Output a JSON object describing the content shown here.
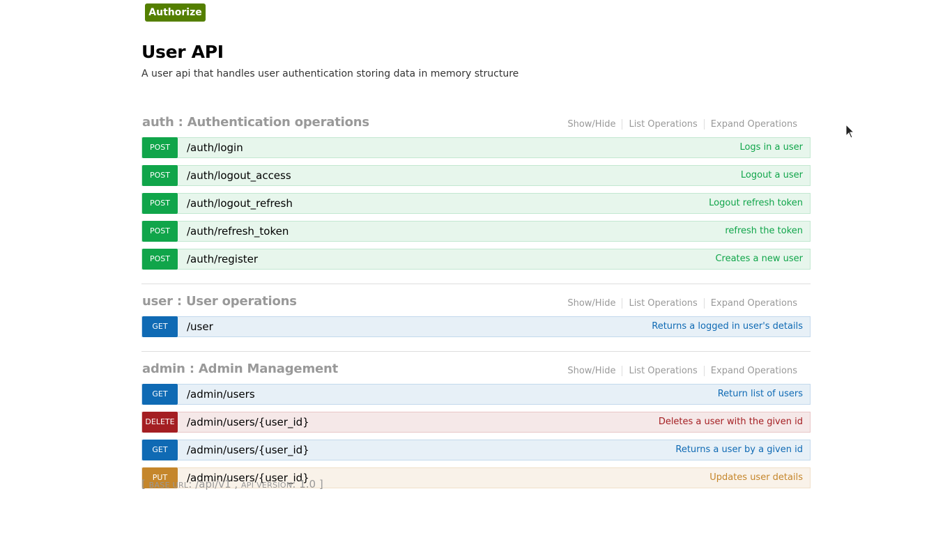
{
  "authorize_label": "Authorize",
  "info": {
    "title": "User API",
    "description": "A user api that handles user authentication storing data in memory structure"
  },
  "resource_links": {
    "show_hide": "Show/Hide",
    "list_operations": "List Operations",
    "expand_operations": "Expand Operations"
  },
  "resources": [
    {
      "title": "auth : Authentication operations",
      "operations": [
        {
          "method": "POST",
          "path": "/auth/login",
          "summary": "Logs in a user"
        },
        {
          "method": "POST",
          "path": "/auth/logout_access",
          "summary": "Logout a user"
        },
        {
          "method": "POST",
          "path": "/auth/logout_refresh",
          "summary": "Logout refresh token"
        },
        {
          "method": "POST",
          "path": "/auth/refresh_token",
          "summary": "refresh the token"
        },
        {
          "method": "POST",
          "path": "/auth/register",
          "summary": "Creates a new user"
        }
      ]
    },
    {
      "title": "user : User operations",
      "operations": [
        {
          "method": "GET",
          "path": "/user",
          "summary": "Returns a logged in user's details"
        }
      ]
    },
    {
      "title": "admin : Admin Management",
      "operations": [
        {
          "method": "GET",
          "path": "/admin/users",
          "summary": "Return list of users"
        },
        {
          "method": "DELETE",
          "path": "/admin/users/{user_id}",
          "summary": "Deletes a user with the given id"
        },
        {
          "method": "GET",
          "path": "/admin/users/{user_id}",
          "summary": "Returns a user by a given id"
        },
        {
          "method": "PUT",
          "path": "/admin/users/{user_id}",
          "summary": "Updates user details"
        }
      ]
    }
  ],
  "footer": {
    "open_bracket": "[",
    "base_url_label": "base url",
    "base_url": "/api/v1",
    "separator": ",",
    "api_version_label": "api version",
    "api_version": "1.0",
    "close_bracket": "]"
  },
  "colors": {
    "post": "#10a54a",
    "get": "#0f6ab4",
    "delete": "#a41e22",
    "put": "#c5862b",
    "authorize": "#547f00"
  },
  "icons": {
    "cursor": "mouse-pointer-icon"
  }
}
